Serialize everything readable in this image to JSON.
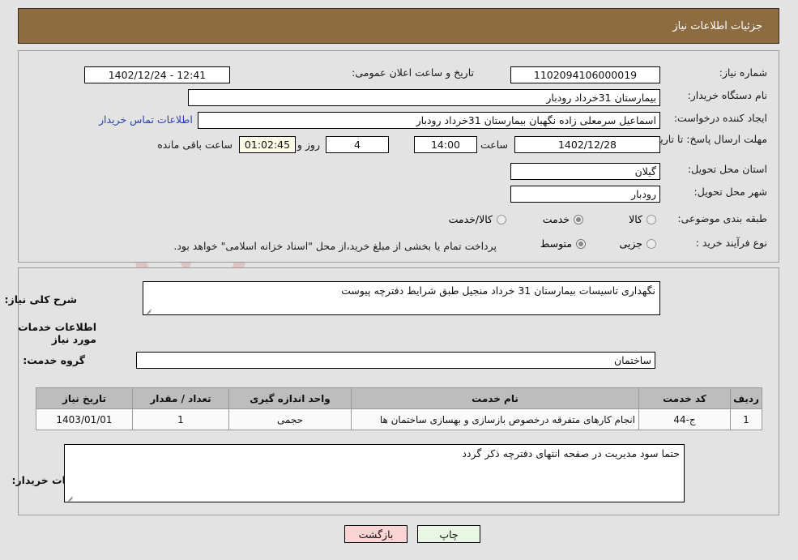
{
  "header": {
    "title": "جزئیات اطلاعات نیاز"
  },
  "form": {
    "need_number_label": "شماره نیاز:",
    "need_number_value": "1102094106000019",
    "announce_label": "تاریخ و ساعت اعلان عمومی:",
    "announce_value": "12:41 - 1402/12/24",
    "buyer_org_label": "نام دستگاه خریدار:",
    "buyer_org_value": "بیمارستان 31خرداد رودبار",
    "creator_label": "ایجاد کننده درخواست:",
    "creator_value": "اسماعیل سرمعلی زاده نگهبان بیمارستان 31خرداد رودبار",
    "contact_link": "اطلاعات تماس خریدار",
    "deadline_label": "مهلت ارسال پاسخ: تا تاریخ:",
    "deadline_date": "1402/12/28",
    "hour_label": "ساعت",
    "deadline_time": "14:00",
    "days_value": "4",
    "days_label": "روز و",
    "countdown_value": "01:02:45",
    "remaining_label": "ساعت باقی مانده",
    "province_label": "استان محل تحویل:",
    "province_value": "گیلان",
    "city_label": "شهر محل تحویل:",
    "city_value": "رودبار",
    "category_label": "طبقه بندی موضوعی:",
    "category_options": [
      {
        "label": "کالا",
        "selected": false
      },
      {
        "label": "خدمت",
        "selected": true
      },
      {
        "label": "کالا/خدمت",
        "selected": false
      }
    ],
    "process_label": "نوع فرآیند خرید :",
    "process_options": [
      {
        "label": "جزیی",
        "selected": false
      },
      {
        "label": "متوسط",
        "selected": true
      }
    ],
    "payment_note": "پرداخت تمام یا بخشی از مبلغ خرید،از محل \"اسناد خزانه اسلامی\" خواهد بود."
  },
  "details": {
    "summary_label": "شرح کلی نیاز:",
    "summary_value": "نگهداری تاسیسات بیمارستان 31 خرداد منجیل طبق شرایط دفترچه پیوست",
    "services_section_title": "اطلاعات خدمات مورد نیاز",
    "service_group_label": "گروه خدمت:",
    "service_group_value": "ساختمان",
    "buyer_notes_label": "توضیحات خریدار:",
    "buyer_notes_value": "حتما سود مدیریت در صفحه انتهای دفترچه ذکر گردد"
  },
  "table": {
    "columns": [
      "ردیف",
      "کد خدمت",
      "نام خدمت",
      "واحد اندازه گیری",
      "تعداد / مقدار",
      "تاریخ نیاز"
    ],
    "rows": [
      {
        "index": "1",
        "code": "ج-44",
        "name": "انجام کارهای متفرقه درخصوص بازسازی و بهسازی ساختمان ها",
        "unit": "حجمی",
        "quantity": "1",
        "date": "1403/01/01"
      }
    ]
  },
  "footer": {
    "print_label": "چاپ",
    "back_label": "بازگشت"
  },
  "watermark": {
    "text": "AriaTender.net"
  },
  "colors": {
    "header_bar": "#8d6c42",
    "page_bg": "#e3e3e3",
    "link": "#2a3fb3",
    "table_header": "#bdbdbd",
    "print_button": "#e9f6e4",
    "back_button": "#fbd5d5",
    "countdown_field": "#fbfbe8"
  }
}
